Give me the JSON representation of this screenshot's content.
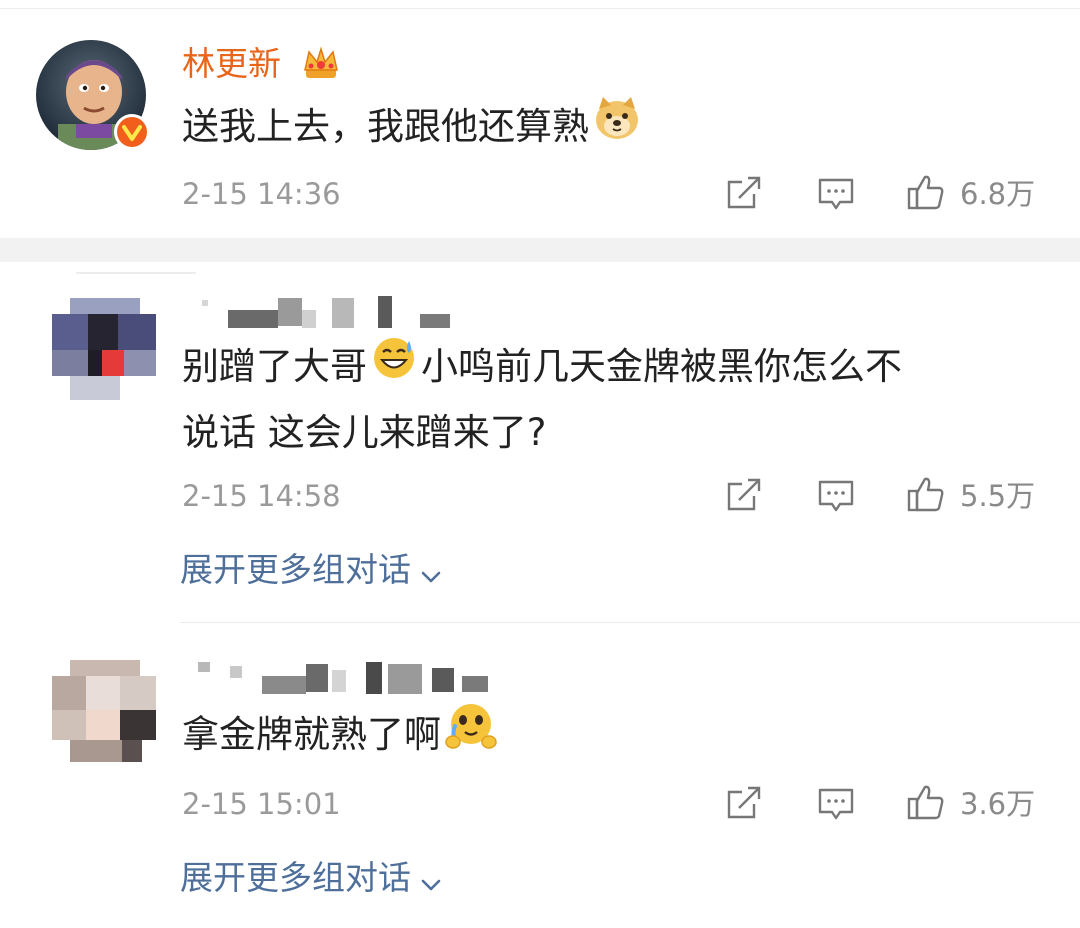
{
  "comments": [
    {
      "username": "林更新",
      "text": "送我上去，我跟他还算熟",
      "time": "2-15 14:36",
      "likes": "6.8万",
      "verified": true
    },
    {
      "text_line1": "别蹭了大哥",
      "text_line1b": "小鸣前几天金牌被黑你怎么不",
      "text_line2": "说话 这会儿来蹭来了?",
      "time": "2-15 14:58",
      "likes": "5.5万",
      "expand_label": "展开更多组对话"
    },
    {
      "text": "拿金牌就熟了啊",
      "time": "2-15 15:01",
      "likes": "3.6万",
      "expand_label": "展开更多组对话"
    }
  ],
  "colors": {
    "username": "#e8651a",
    "link": "#4f6f9b",
    "meta": "#9a9a9a",
    "verified_badge": "#f25f1c"
  }
}
